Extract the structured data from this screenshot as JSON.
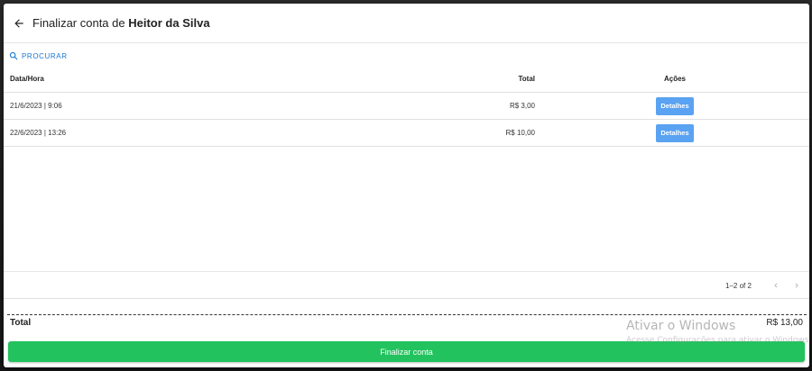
{
  "header": {
    "title_prefix": "Finalizar conta de",
    "customer_name": "Heitor da Silva"
  },
  "search": {
    "label": "PROCURAR",
    "icon": "search-icon"
  },
  "table": {
    "columns": [
      "Data/Hora",
      "Total",
      "Ações"
    ],
    "rows": [
      {
        "datetime": "21/6/2023 | 9:06",
        "total": "R$ 3,00",
        "action": "Detalhes"
      },
      {
        "datetime": "22/6/2023 | 13:26",
        "total": "R$ 10,00",
        "action": "Detalhes"
      }
    ]
  },
  "pagination": {
    "range": "1–2 of 2"
  },
  "summary": {
    "label": "Total",
    "value": "R$ 13,00"
  },
  "finalize_button": {
    "label": "Finalizar conta",
    "color": "#22c35e"
  },
  "watermark": {
    "title": "Ativar o Windows",
    "subtitle": "Acesse Configurações para ativar o Windows."
  },
  "colors": {
    "accent": "#1976d2",
    "details_button": "#5aa2f2"
  }
}
